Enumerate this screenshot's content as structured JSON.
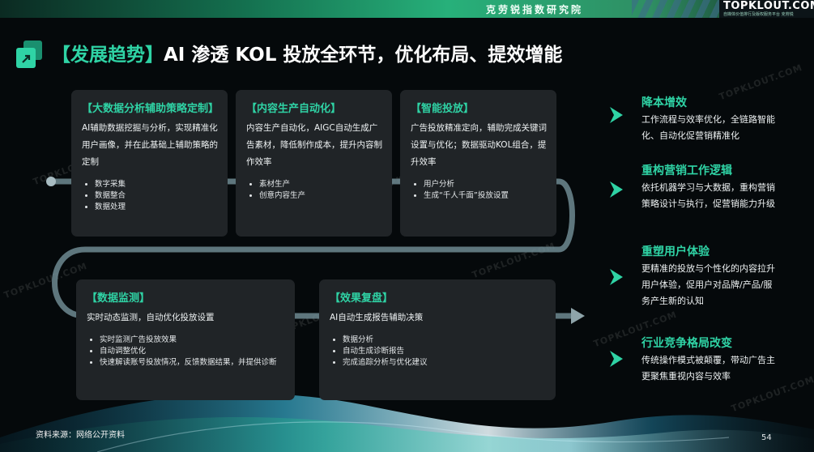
{
  "header": {
    "institute": "克劳锐指数研究院",
    "brand": "TOPKLOUT.COM",
    "brand_sub": "自媒体价值排行及版权服务平台 克劳锐"
  },
  "title": {
    "bracket_label": "【发展趋势】",
    "text": "AI 渗透 KOL 投放全环节，优化布局、提效增能"
  },
  "cards": [
    {
      "title": "【大数据分析辅助策略定制】",
      "desc": "AI辅助数据挖掘与分析，实现精准化用户画像，并在此基础上辅助策略的定制",
      "bullets": [
        "数字采集",
        "数据整合",
        "数据处理"
      ]
    },
    {
      "title": "【内容生产自动化】",
      "desc": "内容生产自动化，AIGC自动生成广告素材，降低制作成本，提升内容制作效率",
      "bullets": [
        "素材生产",
        "创意内容生产"
      ]
    },
    {
      "title": "【智能投放】",
      "desc": "广告投放精准定向，辅助完成关键词设置与优化；数据驱动KOL组合，提升效率",
      "bullets": [
        "用户分析",
        "生成“千人千面”投放设置"
      ]
    },
    {
      "title": "【数据监测】",
      "desc": "实时动态监测，自动优化投放设置",
      "bullets": [
        "实时监测广告投放效果",
        "自动调整优化",
        "快速解读账号投放情况，反馈数据结果，并提供诊断"
      ]
    },
    {
      "title": "【效果复盘】",
      "desc": "AI自动生成报告辅助决策",
      "bullets": [
        "数据分析",
        "自动生成诊断报告",
        "完成追踪分析与优化建议"
      ]
    }
  ],
  "benefits": [
    {
      "title": "降本增效",
      "text": "工作流程与效率优化，全链路智能化、自动化促营销精准化"
    },
    {
      "title": "重构营销工作逻辑",
      "text": "依托机器学习与大数据，重构营销策略设计与执行，促营销能力升级"
    },
    {
      "title": "重塑用户体验",
      "text": "更精准的投放与个性化的内容拉升用户体验，促用户对品牌/产品/服务产生新的认知"
    },
    {
      "title": "行业竞争格局改变",
      "text": "传统操作模式被颠覆，带动广告主更聚焦重视内容与效率"
    }
  ],
  "footer": {
    "source": "资料来源：网络公开资料",
    "page": "54"
  },
  "watermark": "TOPKLOUT.COM",
  "colors": {
    "accent": "#2fd3a5",
    "card_bg": "#202427",
    "bg": "#05090b"
  }
}
